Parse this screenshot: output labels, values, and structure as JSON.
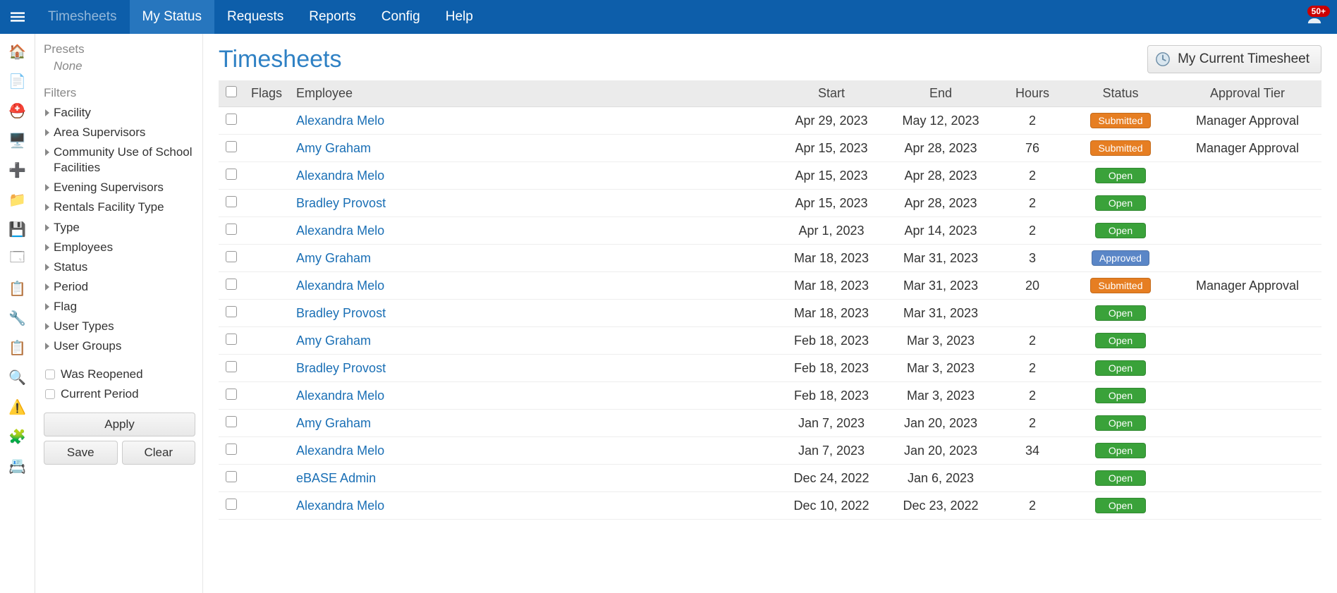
{
  "topnav": {
    "items": [
      {
        "label": "Timesheets",
        "dim": true
      },
      {
        "label": "My Status",
        "active": true
      },
      {
        "label": "Requests"
      },
      {
        "label": "Reports"
      },
      {
        "label": "Config"
      },
      {
        "label": "Help"
      }
    ],
    "notif_count": "50+"
  },
  "rail_icons": [
    "home-icon",
    "document-icon",
    "hardhat-icon",
    "pc-icon",
    "medical-icon",
    "folder-icon",
    "save-icon",
    "windows-icon",
    "clipboard-warn-icon",
    "wrench-icon",
    "clipboard-check-icon",
    "clipboard-search-icon",
    "alarm-icon",
    "puzzle-icon",
    "address-icon"
  ],
  "sidebar": {
    "presets_label": "Presets",
    "presets_none": "None",
    "filters_label": "Filters",
    "expand_filters": [
      "Facility",
      "Area Supervisors",
      "Community Use of School Facilities",
      "Evening Supervisors",
      "Rentals Facility Type",
      "Type",
      "Employees",
      "Status",
      "Period",
      "Flag",
      "User Types",
      "User Groups"
    ],
    "check_filters": [
      "Was Reopened",
      "Current Period"
    ],
    "apply_label": "Apply",
    "save_label": "Save",
    "clear_label": "Clear"
  },
  "page": {
    "title": "Timesheets",
    "current_btn": "My Current Timesheet"
  },
  "table": {
    "headers": {
      "flags": "Flags",
      "employee": "Employee",
      "start": "Start",
      "end": "End",
      "hours": "Hours",
      "status": "Status",
      "tier": "Approval Tier"
    },
    "rows": [
      {
        "employee": "Alexandra Melo",
        "start": "Apr 29, 2023",
        "end": "May 12, 2023",
        "hours": "2",
        "status": "Submitted",
        "tier": "Manager Approval"
      },
      {
        "employee": "Amy Graham",
        "start": "Apr 15, 2023",
        "end": "Apr 28, 2023",
        "hours": "76",
        "status": "Submitted",
        "tier": "Manager Approval"
      },
      {
        "employee": "Alexandra Melo",
        "start": "Apr 15, 2023",
        "end": "Apr 28, 2023",
        "hours": "2",
        "status": "Open",
        "tier": ""
      },
      {
        "employee": "Bradley Provost",
        "start": "Apr 15, 2023",
        "end": "Apr 28, 2023",
        "hours": "2",
        "status": "Open",
        "tier": ""
      },
      {
        "employee": "Alexandra Melo",
        "start": "Apr 1, 2023",
        "end": "Apr 14, 2023",
        "hours": "2",
        "status": "Open",
        "tier": ""
      },
      {
        "employee": "Amy Graham",
        "start": "Mar 18, 2023",
        "end": "Mar 31, 2023",
        "hours": "3",
        "status": "Approved",
        "tier": ""
      },
      {
        "employee": "Alexandra Melo",
        "start": "Mar 18, 2023",
        "end": "Mar 31, 2023",
        "hours": "20",
        "status": "Submitted",
        "tier": "Manager Approval"
      },
      {
        "employee": "Bradley Provost",
        "start": "Mar 18, 2023",
        "end": "Mar 31, 2023",
        "hours": "",
        "status": "Open",
        "tier": ""
      },
      {
        "employee": "Amy Graham",
        "start": "Feb 18, 2023",
        "end": "Mar 3, 2023",
        "hours": "2",
        "status": "Open",
        "tier": ""
      },
      {
        "employee": "Bradley Provost",
        "start": "Feb 18, 2023",
        "end": "Mar 3, 2023",
        "hours": "2",
        "status": "Open",
        "tier": ""
      },
      {
        "employee": "Alexandra Melo",
        "start": "Feb 18, 2023",
        "end": "Mar 3, 2023",
        "hours": "2",
        "status": "Open",
        "tier": ""
      },
      {
        "employee": "Amy Graham",
        "start": "Jan 7, 2023",
        "end": "Jan 20, 2023",
        "hours": "2",
        "status": "Open",
        "tier": ""
      },
      {
        "employee": "Alexandra Melo",
        "start": "Jan 7, 2023",
        "end": "Jan 20, 2023",
        "hours": "34",
        "status": "Open",
        "tier": ""
      },
      {
        "employee": "eBASE Admin",
        "start": "Dec 24, 2022",
        "end": "Jan 6, 2023",
        "hours": "",
        "status": "Open",
        "tier": ""
      },
      {
        "employee": "Alexandra Melo",
        "start": "Dec 10, 2022",
        "end": "Dec 23, 2022",
        "hours": "2",
        "status": "Open",
        "tier": ""
      }
    ]
  }
}
